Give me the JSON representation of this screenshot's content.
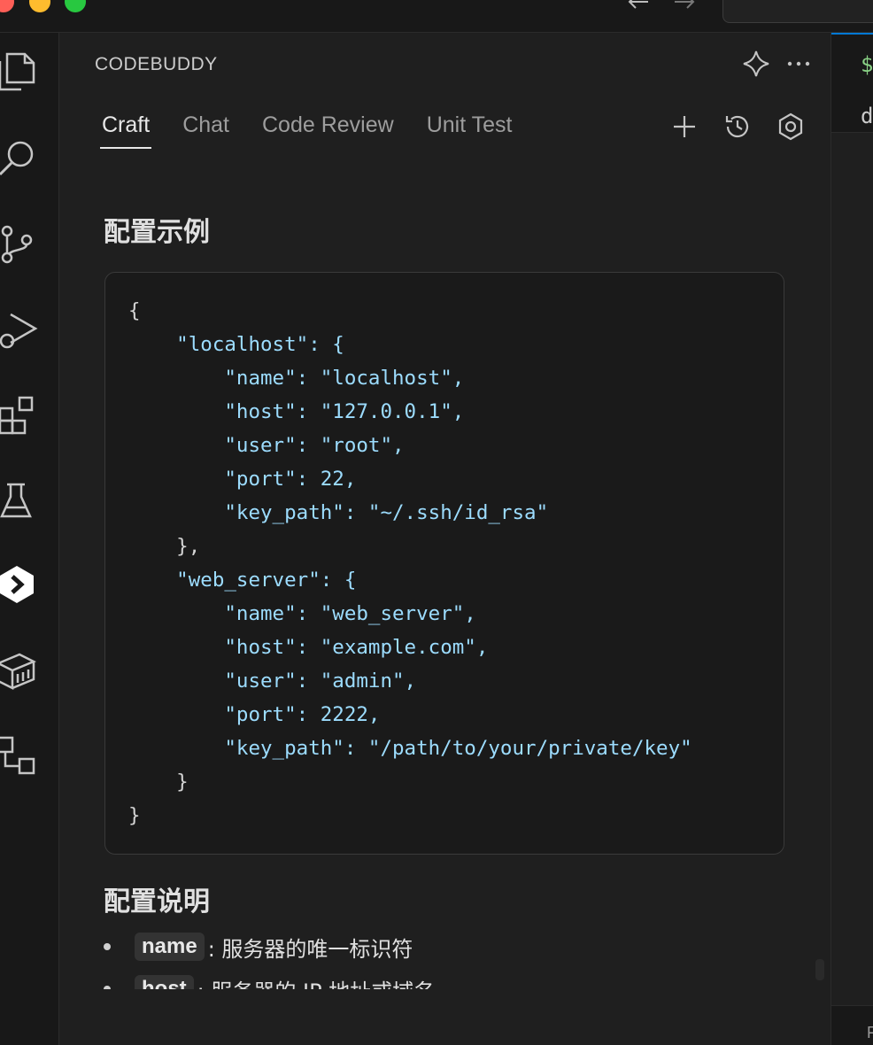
{
  "panel": {
    "title": "CODEBUDDY",
    "tabs": [
      {
        "label": "Craft",
        "active": true
      },
      {
        "label": "Chat",
        "active": false
      },
      {
        "label": "Code Review",
        "active": false
      },
      {
        "label": "Unit Test",
        "active": false
      }
    ]
  },
  "content": {
    "section1_title": "配置示例",
    "code_lines": [
      "{",
      "    \"localhost\": {",
      "        \"name\": \"localhost\",",
      "        \"host\": \"127.0.0.1\",",
      "        \"user\": \"root\",",
      "        \"port\": 22,",
      "        \"key_path\": \"~/.ssh/id_rsa\"",
      "    },",
      "    \"web_server\": {",
      "        \"name\": \"web_server\",",
      "        \"host\": \"example.com\",",
      "        \"user\": \"admin\",",
      "        \"port\": 2222,",
      "        \"key_path\": \"/path/to/your/private/key\"",
      "    }",
      "}"
    ],
    "section2_title": "配置说明",
    "bullets": [
      {
        "code": "name",
        "desc": ": 服务器的唯一标识符"
      },
      {
        "code": "host",
        "desc": ": 服务器的 IP 地址或域名"
      }
    ]
  },
  "editor": {
    "line1": "$",
    "line2": "d",
    "bottom": "F"
  },
  "icons": {
    "activity": [
      "files-icon",
      "search-icon",
      "source-control-icon",
      "run-debug-icon",
      "extensions-icon",
      "testing-icon",
      "codebuddy-icon",
      "containers-icon",
      "remote-explorer-icon"
    ],
    "panel_actions": [
      "sparkle-icon",
      "more-icon"
    ],
    "tab_tools": [
      "plus-icon",
      "history-icon",
      "settings-icon"
    ]
  }
}
